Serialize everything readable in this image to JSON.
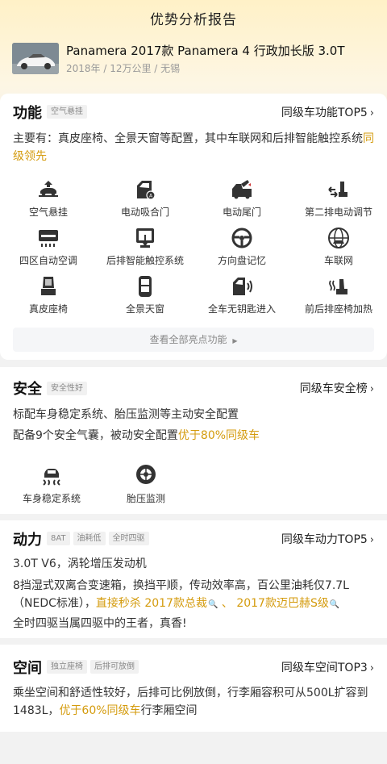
{
  "header": {
    "title": "优势分析报告",
    "car_name": "Panamera 2017款 Panamera 4 行政加长版 3.0T",
    "car_meta": "2018年 / 12万公里 / 无锡"
  },
  "function": {
    "title": "功能",
    "tag": "空气悬挂",
    "rank_link": "同级车功能TOP5",
    "desc_prefix": "主要有：真皮座椅、全景天窗等配置，其中车联网和后排智能触控系统",
    "desc_highlight": "同级领先",
    "features": [
      {
        "label": "空气悬挂",
        "icon": "air-suspension-icon"
      },
      {
        "label": "电动吸合门",
        "icon": "soft-close-door-icon"
      },
      {
        "label": "电动尾门",
        "icon": "power-tailgate-icon"
      },
      {
        "label": "第二排电动调节",
        "icon": "second-row-seat-adjust-icon"
      },
      {
        "label": "四区自动空调",
        "icon": "four-zone-ac-icon"
      },
      {
        "label": "后排智能触控系统",
        "icon": "rear-touch-control-icon"
      },
      {
        "label": "方向盘记忆",
        "icon": "steering-wheel-memory-icon"
      },
      {
        "label": "车联网",
        "icon": "connected-car-icon"
      },
      {
        "label": "真皮座椅",
        "icon": "leather-seat-icon"
      },
      {
        "label": "全景天窗",
        "icon": "panoramic-sunroof-icon"
      },
      {
        "label": "全车无钥匙进入",
        "icon": "keyless-entry-icon"
      },
      {
        "label": "前后排座椅加热",
        "icon": "seat-heating-icon"
      }
    ],
    "view_all": "查看全部亮点功能"
  },
  "safety": {
    "title": "安全",
    "tag": "安全性好",
    "rank_link": "同级车安全榜",
    "line1": "标配车身稳定系统、胎压监测等主动安全配置",
    "line2_prefix": "配备9个安全气囊，被动安全配置",
    "line2_highlight": "优于80%同级车",
    "features": [
      {
        "label": "车身稳定系统",
        "icon": "stability-control-icon"
      },
      {
        "label": "胎压监测",
        "icon": "tire-pressure-icon"
      }
    ]
  },
  "power": {
    "title": "动力",
    "tags": [
      "8AT",
      "油耗低",
      "全时四驱"
    ],
    "rank_link": "同级车动力TOP5",
    "engine": "3.0T V6，涡轮增压发动机",
    "trans_prefix": "8挡湿式双离合变速箱，换挡平顺，传动效率高，百公里油耗仅7.7L（NEDC标准），",
    "trans_highlight1": "直接秒杀 2017款总裁",
    "trans_sep": " 、 ",
    "trans_highlight2": "2017款迈巴赫S级",
    "awd": "全时四驱当属四驱中的王者，真香!"
  },
  "space": {
    "title": "空间",
    "tags": [
      "独立座椅",
      "后排可放倒"
    ],
    "rank_link": "同级车空间TOP3",
    "desc_prefix": "乘坐空间和舒适性较好，后排可比例放倒，行李厢容积可从500L扩容到1483L，",
    "desc_highlight": "优于60%同级车",
    "desc_suffix": "行李厢空间"
  },
  "colors": {
    "accent": "#d49b0d",
    "hero_top": "#fff1c7"
  }
}
